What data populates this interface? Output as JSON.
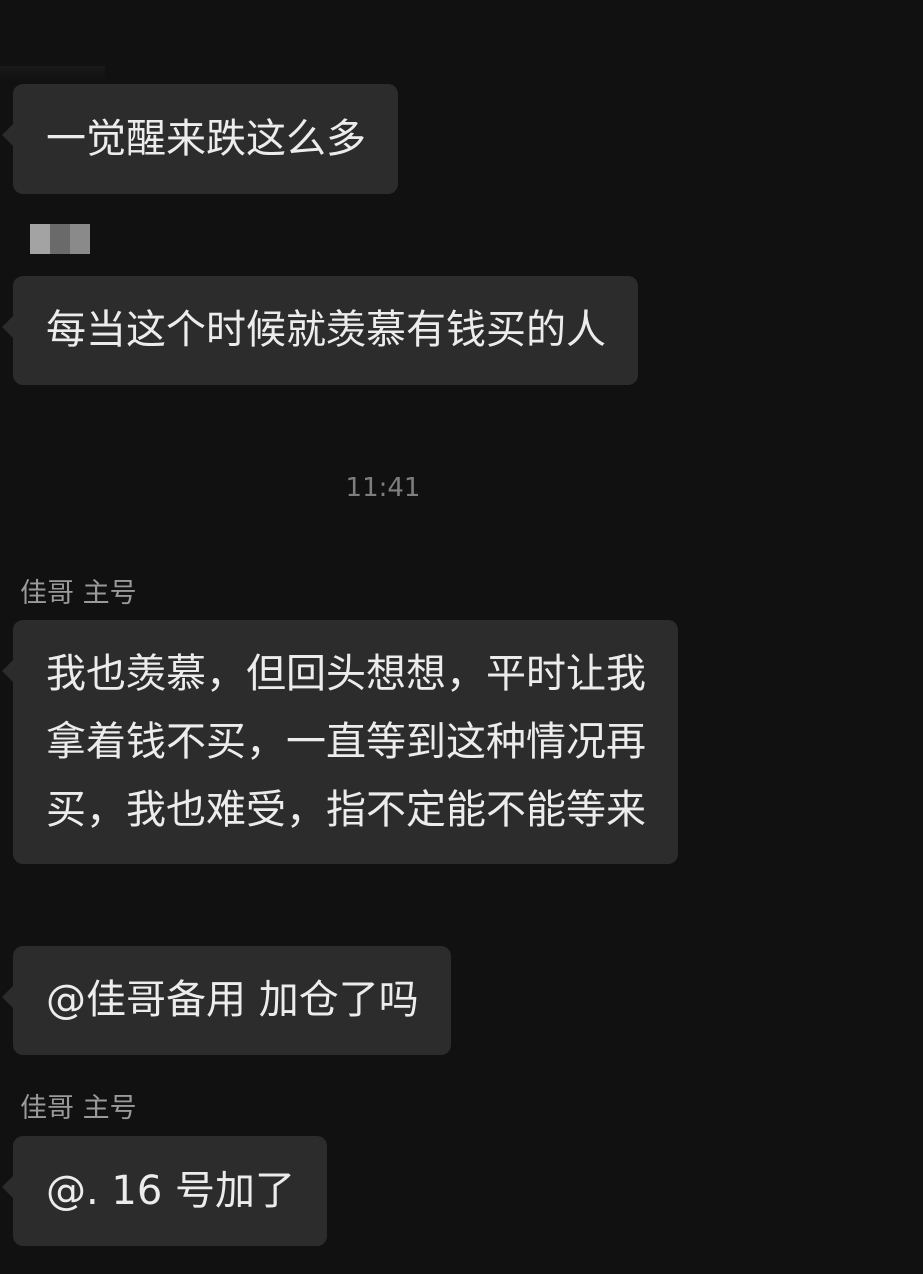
{
  "messages": [
    {
      "text": "一觉醒来跌这么多"
    },
    {
      "text": "每当这个时候就羡慕有钱买的人"
    },
    {
      "sender": "佳哥 主号",
      "lines": [
        "我也羡慕，但回头想想，平时让我",
        "拿着钱不买，一直等到这种情况再",
        "买，我也难受，指不定能不能等来"
      ]
    },
    {
      "text": "@佳哥备用  加仓了吗"
    },
    {
      "sender": "佳哥 主号",
      "text": "@. 16 号加了"
    }
  ],
  "timestamp": "11:41",
  "colors": {
    "background": "#111111",
    "bubble": "#2c2c2c",
    "text": "#ececec",
    "meta_text": "#9a9a9a"
  }
}
